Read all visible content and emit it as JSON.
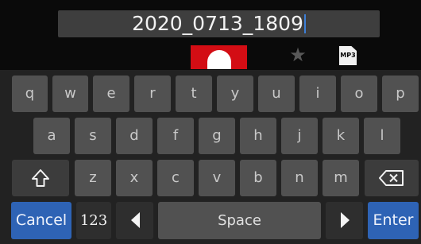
{
  "file_name": {
    "value": "2020_0713_1809"
  },
  "indicators": {
    "recording_color": "#d30d14",
    "star_icon": "star-icon",
    "mp3_label": "MP3"
  },
  "keyboard": {
    "row1": [
      "q",
      "w",
      "e",
      "r",
      "t",
      "y",
      "u",
      "i",
      "o",
      "p"
    ],
    "row2": [
      "a",
      "s",
      "d",
      "f",
      "g",
      "h",
      "j",
      "k",
      "l"
    ],
    "row3": [
      "z",
      "x",
      "c",
      "v",
      "b",
      "n",
      "m"
    ],
    "shift_icon": "shift-arrow-up-icon",
    "backspace_icon": "backspace-icon",
    "cancel_label": "Cancel",
    "numbers_label": "123",
    "cursor_left_icon": "triangle-left-icon",
    "space_label": "Space",
    "cursor_right_icon": "triangle-right-icon",
    "enter_label": "Enter",
    "accent_color": "#2e63b5"
  }
}
